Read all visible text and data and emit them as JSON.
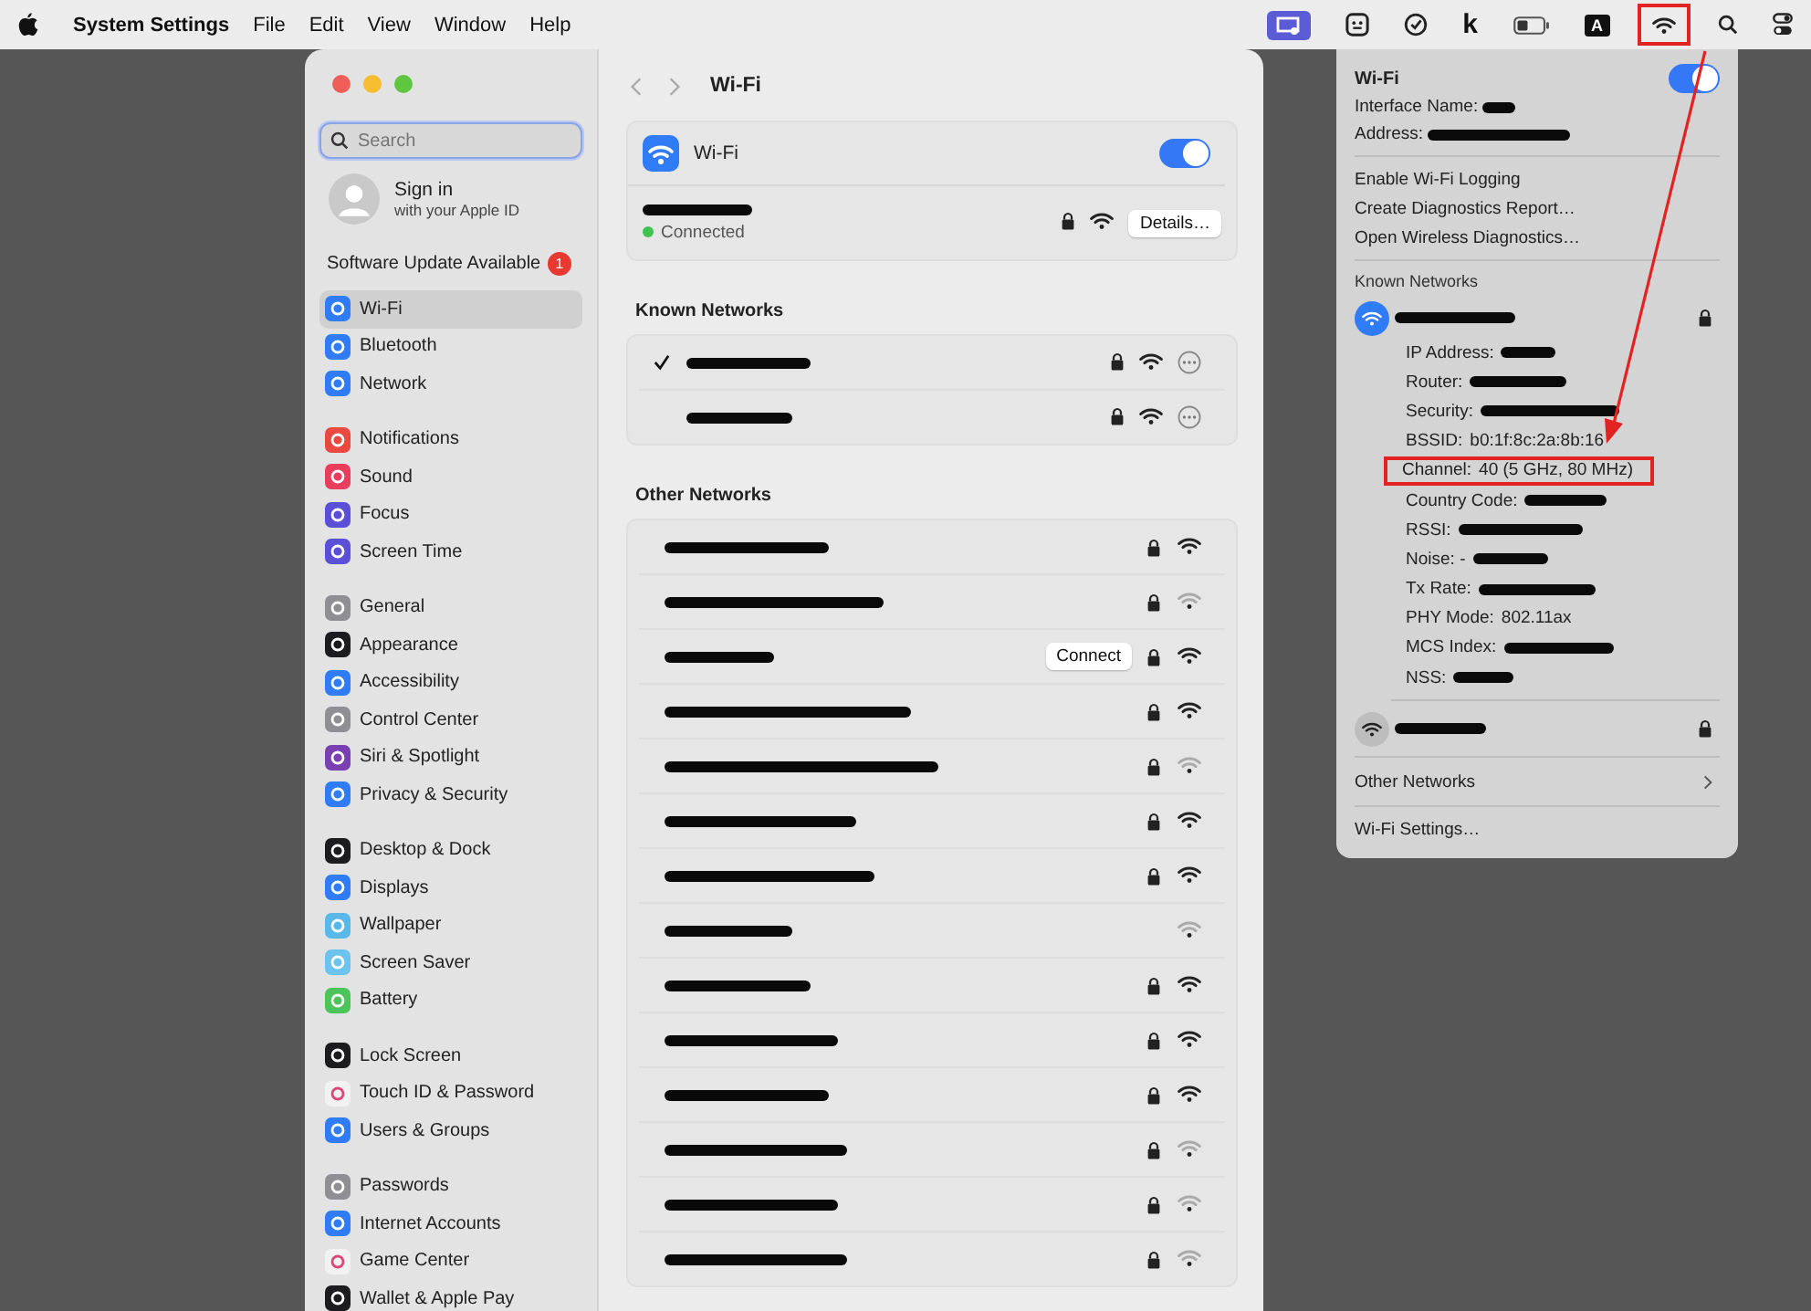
{
  "menu_bar": {
    "app_name": "System Settings",
    "menus": [
      "File",
      "Edit",
      "View",
      "Window",
      "Help"
    ],
    "status_items": [
      {
        "kind": "screen",
        "highlighted": false
      },
      {
        "kind": "face",
        "highlighted": false
      },
      {
        "kind": "check",
        "highlighted": false
      },
      {
        "kind": "letter",
        "text": "k",
        "highlighted": false
      },
      {
        "kind": "battery",
        "highlighted": false
      },
      {
        "kind": "input",
        "text": "A",
        "highlighted": false
      },
      {
        "kind": "wifi",
        "highlighted": true
      },
      {
        "kind": "search",
        "highlighted": false
      },
      {
        "kind": "control",
        "highlighted": false
      }
    ]
  },
  "sidebar": {
    "search": {
      "placeholder": "Search",
      "focused": true
    },
    "account": {
      "title": "Sign in",
      "subtitle": "with your Apple ID"
    },
    "update": {
      "label": "Software Update Available",
      "badge": "1"
    },
    "groups": [
      [
        {
          "label": "Wi-Fi",
          "color": "#2f7cf6",
          "selected": true
        },
        {
          "label": "Bluetooth",
          "color": "#2f7cf6",
          "selected": false
        },
        {
          "label": "Network",
          "color": "#2f7cf6",
          "selected": false
        }
      ],
      [
        {
          "label": "Notifications",
          "color": "#e9493f",
          "selected": false
        },
        {
          "label": "Sound",
          "color": "#e83e5c",
          "selected": false
        },
        {
          "label": "Focus",
          "color": "#5a4fd6",
          "selected": false
        },
        {
          "label": "Screen Time",
          "color": "#5a4fd6",
          "selected": false
        }
      ],
      [
        {
          "label": "General",
          "color": "#8e8e93",
          "selected": false
        },
        {
          "label": "Appearance",
          "color": "#1c1c1e",
          "selected": false
        },
        {
          "label": "Accessibility",
          "color": "#2f7cf6",
          "selected": false
        },
        {
          "label": "Control Center",
          "color": "#8e8e93",
          "selected": false
        },
        {
          "label": "Siri & Spotlight",
          "color": "#7a3fb0",
          "selected": false
        },
        {
          "label": "Privacy & Security",
          "color": "#2f7cf6",
          "selected": false
        }
      ],
      [
        {
          "label": "Desktop & Dock",
          "color": "#1c1c1e",
          "selected": false
        },
        {
          "label": "Displays",
          "color": "#2f7cf6",
          "selected": false
        },
        {
          "label": "Wallpaper",
          "color": "#5ab8e8",
          "selected": false
        },
        {
          "label": "Screen Saver",
          "color": "#6cc4ee",
          "selected": false
        },
        {
          "label": "Battery",
          "color": "#4cc459",
          "selected": false
        }
      ],
      [
        {
          "label": "Lock Screen",
          "color": "#1c1c1e",
          "selected": false
        },
        {
          "label": "Touch ID & Password",
          "color": "#f2f2f2",
          "selected": false
        },
        {
          "label": "Users & Groups",
          "color": "#2f7cf6",
          "selected": false
        }
      ],
      [
        {
          "label": "Passwords",
          "color": "#8e8e93",
          "selected": false
        },
        {
          "label": "Internet Accounts",
          "color": "#2f7cf6",
          "selected": false
        },
        {
          "label": "Game Center",
          "color": "#f2f2f2",
          "selected": false
        },
        {
          "label": "Wallet & Apple Pay",
          "color": "#1c1c1e",
          "selected": false
        }
      ]
    ]
  },
  "main": {
    "title": "Wi-Fi",
    "wifi": {
      "label": "Wi-Fi",
      "on": true
    },
    "current": {
      "status": "Connected",
      "locked": true,
      "strong": true,
      "button": "Details…"
    },
    "known_heading": "Known Networks",
    "known": [
      {
        "connected": true,
        "locked": true,
        "strong": true
      },
      {
        "connected": false,
        "locked": true,
        "strong": true
      }
    ],
    "other_heading": "Other Networks",
    "other": [
      {
        "locked": true,
        "strong": true
      },
      {
        "locked": true,
        "strong": false
      },
      {
        "locked": true,
        "strong": true,
        "button": "Connect"
      },
      {
        "locked": true,
        "strong": true
      },
      {
        "locked": true,
        "strong": false
      },
      {
        "locked": true,
        "strong": true
      },
      {
        "locked": true,
        "strong": true
      },
      {
        "locked": false,
        "strong": false
      },
      {
        "locked": true,
        "strong": true
      },
      {
        "locked": true,
        "strong": true
      },
      {
        "locked": true,
        "strong": true
      },
      {
        "locked": true,
        "strong": false
      },
      {
        "locked": true,
        "strong": false
      },
      {
        "locked": true,
        "strong": false
      }
    ]
  },
  "wifi_menu": {
    "title": "Wi-Fi",
    "on": true,
    "info": [
      {
        "label": "Interface Name:",
        "redacted": true
      },
      {
        "label": "Address:",
        "redacted": true
      }
    ],
    "actions": [
      "Enable Wi-Fi Logging",
      "Create Diagnostics Report…",
      "Open Wireless Diagnostics…"
    ],
    "known_heading": "Known Networks",
    "networks": [
      {
        "active": true,
        "locked": true,
        "details": [
          {
            "label": "IP Address:",
            "redacted": true,
            "highlighted": false
          },
          {
            "label": "Router:",
            "redacted": true,
            "highlighted": false
          },
          {
            "label": "Security:",
            "redacted": true,
            "highlighted": false
          },
          {
            "label": "BSSID:",
            "value": "b0:1f:8c:2a:8b:16",
            "redacted": false,
            "highlighted": false
          },
          {
            "label": "Channel:",
            "value": "40 (5 GHz, 80 MHz)",
            "redacted": false,
            "highlighted": true
          },
          {
            "label": "Country Code:",
            "redacted": true,
            "highlighted": false
          },
          {
            "label": "RSSI:",
            "redacted": true,
            "highlighted": false
          },
          {
            "label": "Noise: -",
            "redacted": true,
            "highlighted": false
          },
          {
            "label": "Tx Rate:",
            "redacted": true,
            "highlighted": false
          },
          {
            "label": "PHY Mode:",
            "value": "802.11ax",
            "redacted": false,
            "highlighted": false
          },
          {
            "label": "MCS Index:",
            "redacted": true,
            "highlighted": false
          },
          {
            "label": "NSS:",
            "redacted": true,
            "highlighted": false
          }
        ]
      },
      {
        "active": false,
        "locked": true
      }
    ],
    "other_label": "Other Networks",
    "settings_label": "Wi-Fi Settings…"
  }
}
